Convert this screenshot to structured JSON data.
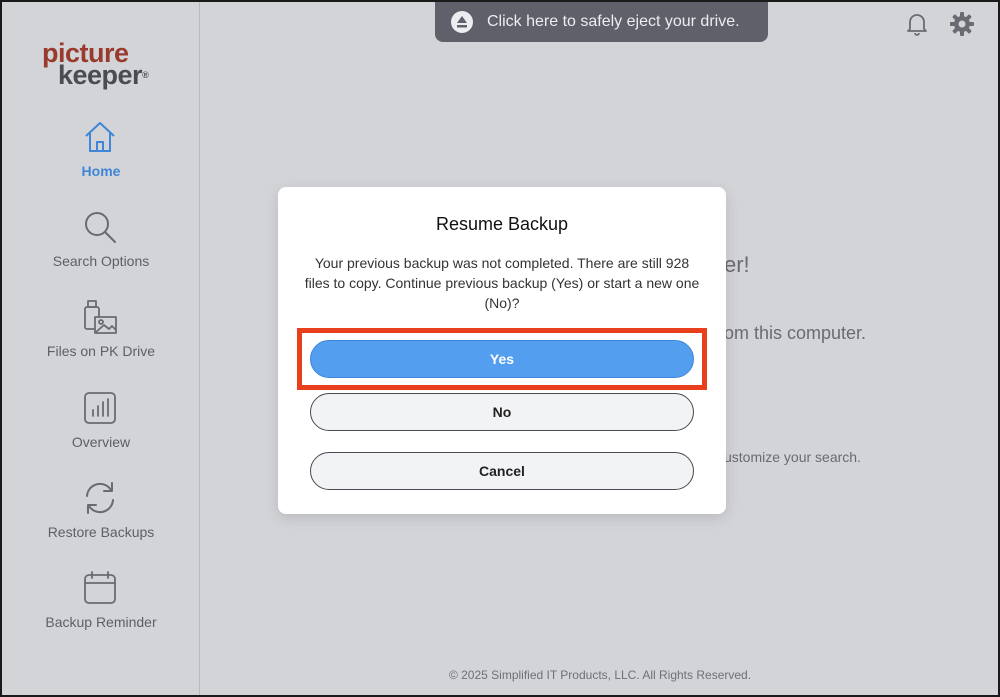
{
  "logo": {
    "line1": "picture",
    "line2": "keeper",
    "trademark": "®"
  },
  "sidebar": {
    "items": [
      {
        "label": "Home",
        "icon": "home-icon",
        "active": true
      },
      {
        "label": "Search Options",
        "icon": "magnifier-icon",
        "active": false
      },
      {
        "label": "Files on PK Drive",
        "icon": "usb-drive-icon",
        "active": false
      },
      {
        "label": "Overview",
        "icon": "bar-chart-icon",
        "active": false
      },
      {
        "label": "Restore Backups",
        "icon": "refresh-icon",
        "active": false
      },
      {
        "label": "Backup Reminder",
        "icon": "calendar-icon",
        "active": false
      }
    ]
  },
  "banner": {
    "text": "Click here to safely eject your drive.",
    "icon": "eject-icon"
  },
  "topbar": {
    "notifications_icon": "bell-icon",
    "settings_icon": "gear-icon"
  },
  "background": {
    "line1": "er!",
    "line2": "om this computer.",
    "line3": "ustomize your search."
  },
  "footer": {
    "text": "© 2025 Simplified IT Products, LLC. All Rights Reserved."
  },
  "dialog": {
    "title": "Resume Backup",
    "message": "Your previous backup was not completed. There are still 928 files to copy. Continue previous backup (Yes) or start a new one (No)?",
    "yes_label": "Yes",
    "no_label": "No",
    "cancel_label": "Cancel"
  },
  "colors": {
    "accent": "#549ef0",
    "active_nav": "#3f86d8",
    "highlight": "#e8401c",
    "logo_red": "#9a3a2c",
    "logo_gray": "#4b4c52"
  }
}
